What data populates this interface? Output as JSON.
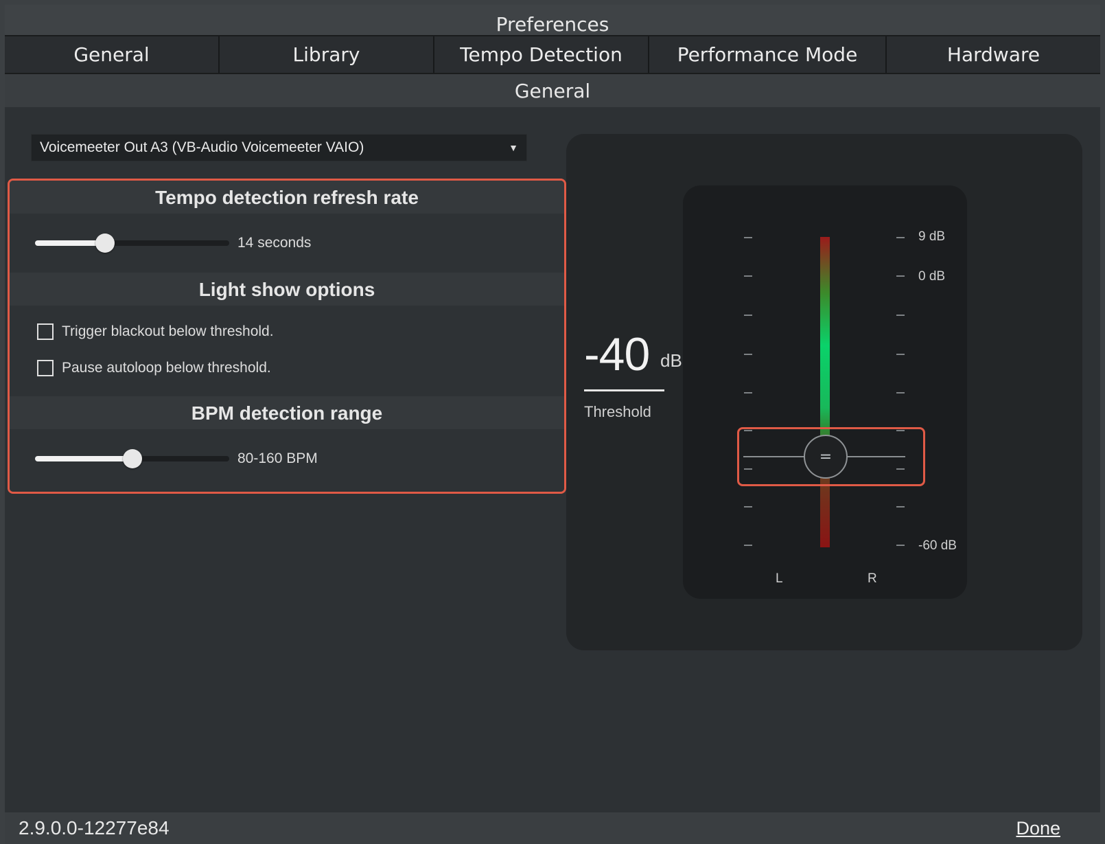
{
  "window": {
    "title": "Preferences"
  },
  "tabs": [
    {
      "label": "General"
    },
    {
      "label": "Library"
    },
    {
      "label": "Tempo Detection"
    },
    {
      "label": "Performance Mode"
    },
    {
      "label": "Hardware"
    }
  ],
  "section": {
    "title": "General"
  },
  "device": {
    "selected": "Voicemeeter Out A3 (VB-Audio Voicemeeter VAIO)",
    "arrow_icon": "triangle-down"
  },
  "refresh_rate": {
    "title": "Tempo detection refresh rate",
    "value_label": "14 seconds",
    "fraction": 0.36
  },
  "light_show": {
    "title": "Light show options",
    "options": [
      {
        "label": "Trigger blackout below threshold.",
        "checked": false
      },
      {
        "label": "Pause autoloop below threshold.",
        "checked": false
      }
    ]
  },
  "bpm_range": {
    "title": "BPM detection range",
    "value_label": "80-160 BPM",
    "fraction": 0.5
  },
  "threshold": {
    "value": "-40",
    "unit": "dB",
    "label": "Threshold"
  },
  "meter": {
    "db_labels": {
      "top": "9 dB",
      "zero": "0 dB",
      "bottom": "-60 dB"
    },
    "channels": {
      "left": "L",
      "right": "R"
    },
    "handle_glyph": "="
  },
  "footer": {
    "version": "2.9.0.0-12277e84",
    "done_label": "Done"
  }
}
